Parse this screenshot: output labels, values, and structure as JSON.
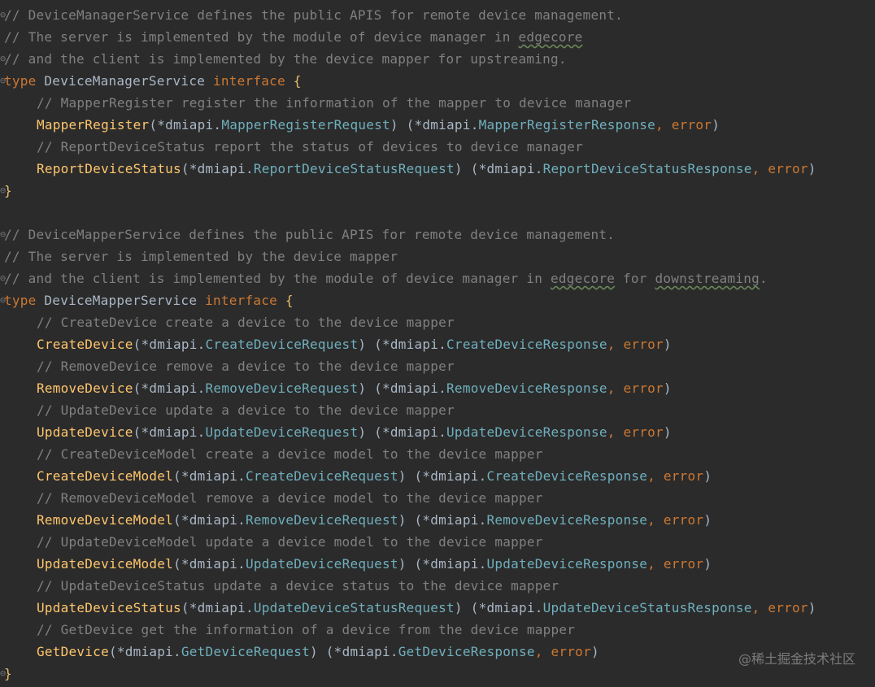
{
  "colors": {
    "background": "#2b2b2b",
    "comment": "#808080",
    "keyword": "#cc7832",
    "identifier": "#a9b7c6",
    "function": "#ffc66d",
    "type": "#6fafbd",
    "brace": "#e8bf6a"
  },
  "lines": [
    {
      "indent": false,
      "fold": true,
      "tokens": [
        {
          "t": "comment",
          "v": "// DeviceManagerService defines the public APIS for remote device management."
        }
      ]
    },
    {
      "indent": false,
      "fold": false,
      "tokens": [
        {
          "t": "comment",
          "v": "// The server is implemented by the module of device manager in "
        },
        {
          "t": "comment",
          "v": "edgecore",
          "typo": true
        }
      ]
    },
    {
      "indent": false,
      "fold": true,
      "tokens": [
        {
          "t": "comment",
          "v": "// and the client is implemented by the device mapper for upstreaming."
        }
      ]
    },
    {
      "indent": false,
      "fold": true,
      "tokens": [
        {
          "t": "keyword",
          "v": "type "
        },
        {
          "t": "ident",
          "v": "DeviceManagerService "
        },
        {
          "t": "keyword",
          "v": "interface "
        },
        {
          "t": "brace",
          "v": "{"
        }
      ]
    },
    {
      "indent": true,
      "fold": false,
      "tokens": [
        {
          "t": "comment",
          "v": "// MapperRegister register the information of the mapper to device manager"
        }
      ]
    },
    {
      "indent": true,
      "fold": false,
      "tokens": [
        {
          "t": "func",
          "v": "MapperRegister"
        },
        {
          "t": "text",
          "v": "(*dmiapi."
        },
        {
          "t": "type",
          "v": "MapperRegisterRequest"
        },
        {
          "t": "text",
          "v": ") (*dmiapi."
        },
        {
          "t": "type",
          "v": "MapperRegisterResponse"
        },
        {
          "t": "keyword",
          "v": ", "
        },
        {
          "t": "keyword",
          "v": "error"
        },
        {
          "t": "text",
          "v": ")"
        }
      ]
    },
    {
      "indent": true,
      "fold": false,
      "tokens": [
        {
          "t": "comment",
          "v": "// ReportDeviceStatus report the status of devices to device manager"
        }
      ]
    },
    {
      "indent": true,
      "fold": false,
      "tokens": [
        {
          "t": "func",
          "v": "ReportDeviceStatus"
        },
        {
          "t": "text",
          "v": "(*dmiapi."
        },
        {
          "t": "type",
          "v": "ReportDeviceStatusRequest"
        },
        {
          "t": "text",
          "v": ") (*dmiapi."
        },
        {
          "t": "type",
          "v": "ReportDeviceStatusResponse"
        },
        {
          "t": "keyword",
          "v": ", "
        },
        {
          "t": "keyword",
          "v": "error"
        },
        {
          "t": "text",
          "v": ")"
        }
      ]
    },
    {
      "indent": false,
      "fold": true,
      "tokens": [
        {
          "t": "brace",
          "v": "}"
        }
      ]
    },
    {
      "indent": false,
      "fold": false,
      "tokens": []
    },
    {
      "indent": false,
      "fold": true,
      "tokens": [
        {
          "t": "comment",
          "v": "// DeviceMapperService defines the public APIS for remote device management."
        }
      ]
    },
    {
      "indent": false,
      "fold": false,
      "tokens": [
        {
          "t": "comment",
          "v": "// The server is implemented by the device mapper"
        }
      ]
    },
    {
      "indent": false,
      "fold": true,
      "tokens": [
        {
          "t": "comment",
          "v": "// and the client is implemented by the module of device manager in "
        },
        {
          "t": "comment",
          "v": "edgecore",
          "typo": true
        },
        {
          "t": "comment",
          "v": " for "
        },
        {
          "t": "comment",
          "v": "downstreaming",
          "typo": true
        },
        {
          "t": "comment",
          "v": "."
        }
      ]
    },
    {
      "indent": false,
      "fold": true,
      "tokens": [
        {
          "t": "keyword",
          "v": "type "
        },
        {
          "t": "ident",
          "v": "DeviceMapperService "
        },
        {
          "t": "keyword",
          "v": "interface "
        },
        {
          "t": "brace",
          "v": "{"
        }
      ]
    },
    {
      "indent": true,
      "fold": false,
      "tokens": [
        {
          "t": "comment",
          "v": "// CreateDevice create a device to the device mapper"
        }
      ]
    },
    {
      "indent": true,
      "fold": false,
      "tokens": [
        {
          "t": "func",
          "v": "CreateDevice"
        },
        {
          "t": "text",
          "v": "(*dmiapi."
        },
        {
          "t": "type",
          "v": "CreateDeviceRequest"
        },
        {
          "t": "text",
          "v": ") (*dmiapi."
        },
        {
          "t": "type",
          "v": "CreateDeviceResponse"
        },
        {
          "t": "keyword",
          "v": ", "
        },
        {
          "t": "keyword",
          "v": "error"
        },
        {
          "t": "text",
          "v": ")"
        }
      ]
    },
    {
      "indent": true,
      "fold": false,
      "tokens": [
        {
          "t": "comment",
          "v": "// RemoveDevice remove a device to the device mapper"
        }
      ]
    },
    {
      "indent": true,
      "fold": false,
      "tokens": [
        {
          "t": "func",
          "v": "RemoveDevice"
        },
        {
          "t": "text",
          "v": "(*dmiapi."
        },
        {
          "t": "type",
          "v": "RemoveDeviceRequest"
        },
        {
          "t": "text",
          "v": ") (*dmiapi."
        },
        {
          "t": "type",
          "v": "RemoveDeviceResponse"
        },
        {
          "t": "keyword",
          "v": ", "
        },
        {
          "t": "keyword",
          "v": "error"
        },
        {
          "t": "text",
          "v": ")"
        }
      ]
    },
    {
      "indent": true,
      "fold": false,
      "tokens": [
        {
          "t": "comment",
          "v": "// UpdateDevice update a device to the device mapper"
        }
      ]
    },
    {
      "indent": true,
      "fold": false,
      "tokens": [
        {
          "t": "func",
          "v": "UpdateDevice"
        },
        {
          "t": "text",
          "v": "(*dmiapi."
        },
        {
          "t": "type",
          "v": "UpdateDeviceRequest"
        },
        {
          "t": "text",
          "v": ") (*dmiapi."
        },
        {
          "t": "type",
          "v": "UpdateDeviceResponse"
        },
        {
          "t": "keyword",
          "v": ", "
        },
        {
          "t": "keyword",
          "v": "error"
        },
        {
          "t": "text",
          "v": ")"
        }
      ]
    },
    {
      "indent": true,
      "fold": false,
      "tokens": [
        {
          "t": "comment",
          "v": "// CreateDeviceModel create a device model to the device mapper"
        }
      ]
    },
    {
      "indent": true,
      "fold": false,
      "tokens": [
        {
          "t": "func",
          "v": "CreateDeviceModel"
        },
        {
          "t": "text",
          "v": "(*dmiapi."
        },
        {
          "t": "type",
          "v": "CreateDeviceRequest"
        },
        {
          "t": "text",
          "v": ") (*dmiapi."
        },
        {
          "t": "type",
          "v": "CreateDeviceResponse"
        },
        {
          "t": "keyword",
          "v": ", "
        },
        {
          "t": "keyword",
          "v": "error"
        },
        {
          "t": "text",
          "v": ")"
        }
      ]
    },
    {
      "indent": true,
      "fold": false,
      "tokens": [
        {
          "t": "comment",
          "v": "// RemoveDeviceModel remove a device model to the device mapper"
        }
      ]
    },
    {
      "indent": true,
      "fold": false,
      "tokens": [
        {
          "t": "func",
          "v": "RemoveDeviceModel"
        },
        {
          "t": "text",
          "v": "(*dmiapi."
        },
        {
          "t": "type",
          "v": "RemoveDeviceRequest"
        },
        {
          "t": "text",
          "v": ") (*dmiapi."
        },
        {
          "t": "type",
          "v": "RemoveDeviceResponse"
        },
        {
          "t": "keyword",
          "v": ", "
        },
        {
          "t": "keyword",
          "v": "error"
        },
        {
          "t": "text",
          "v": ")"
        }
      ]
    },
    {
      "indent": true,
      "fold": false,
      "tokens": [
        {
          "t": "comment",
          "v": "// UpdateDeviceModel update a device model to the device mapper"
        }
      ]
    },
    {
      "indent": true,
      "fold": false,
      "tokens": [
        {
          "t": "func",
          "v": "UpdateDeviceModel"
        },
        {
          "t": "text",
          "v": "(*dmiapi."
        },
        {
          "t": "type",
          "v": "UpdateDeviceRequest"
        },
        {
          "t": "text",
          "v": ") (*dmiapi."
        },
        {
          "t": "type",
          "v": "UpdateDeviceResponse"
        },
        {
          "t": "keyword",
          "v": ", "
        },
        {
          "t": "keyword",
          "v": "error"
        },
        {
          "t": "text",
          "v": ")"
        }
      ]
    },
    {
      "indent": true,
      "fold": false,
      "tokens": [
        {
          "t": "comment",
          "v": "// UpdateDeviceStatus update a device status to the device mapper"
        }
      ]
    },
    {
      "indent": true,
      "fold": false,
      "tokens": [
        {
          "t": "func",
          "v": "UpdateDeviceStatus"
        },
        {
          "t": "text",
          "v": "(*dmiapi."
        },
        {
          "t": "type",
          "v": "UpdateDeviceStatusRequest"
        },
        {
          "t": "text",
          "v": ") (*dmiapi."
        },
        {
          "t": "type",
          "v": "UpdateDeviceStatusResponse"
        },
        {
          "t": "keyword",
          "v": ", "
        },
        {
          "t": "keyword",
          "v": "error"
        },
        {
          "t": "text",
          "v": ")"
        }
      ]
    },
    {
      "indent": true,
      "fold": false,
      "tokens": [
        {
          "t": "comment",
          "v": "// GetDevice get the information of a device from the device mapper"
        }
      ]
    },
    {
      "indent": true,
      "fold": false,
      "tokens": [
        {
          "t": "func",
          "v": "GetDevice"
        },
        {
          "t": "text",
          "v": "(*dmiapi."
        },
        {
          "t": "type",
          "v": "GetDeviceRequest"
        },
        {
          "t": "text",
          "v": ") (*dmiapi."
        },
        {
          "t": "type",
          "v": "GetDeviceResponse"
        },
        {
          "t": "keyword",
          "v": ", "
        },
        {
          "t": "keyword",
          "v": "error"
        },
        {
          "t": "text",
          "v": ")"
        }
      ]
    },
    {
      "indent": false,
      "fold": true,
      "tokens": [
        {
          "t": "brace",
          "v": "}"
        }
      ]
    }
  ],
  "watermark": "@稀土掘金技术社区"
}
